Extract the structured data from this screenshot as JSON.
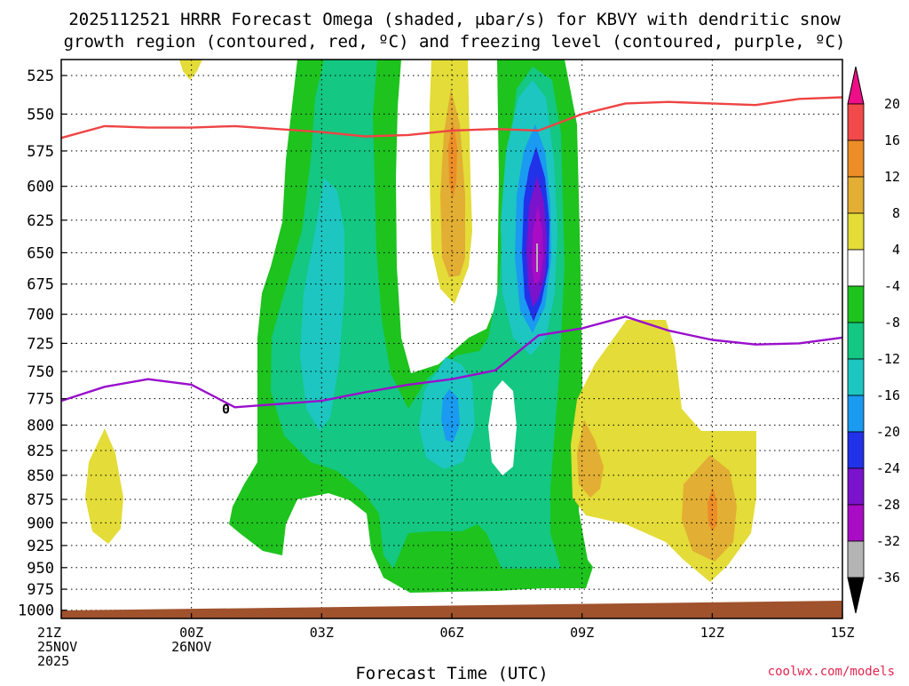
{
  "title": {
    "line1": "2025112521 HRRR Forecast Omega (shaded, μbar/s) for KBVY with dendritic snow",
    "line2": "growth region (contoured, red, ºC) and freezing level (contoured, purple, ºC)"
  },
  "credit": "coolwx.com/models",
  "chart_data": {
    "type": "area",
    "xlabel": "Forecast Time (UTC)",
    "ylabel": "",
    "x_ticks": [
      {
        "hour": 0,
        "label1": "21Z",
        "label2": "25NOV",
        "label3": "2025"
      },
      {
        "hour": 3,
        "label1": "00Z",
        "label2": "26NOV",
        "label3": ""
      },
      {
        "hour": 6,
        "label1": "03Z",
        "label2": "",
        "label3": ""
      },
      {
        "hour": 9,
        "label1": "06Z",
        "label2": "",
        "label3": ""
      },
      {
        "hour": 12,
        "label1": "09Z",
        "label2": "",
        "label3": ""
      },
      {
        "hour": 15,
        "label1": "12Z",
        "label2": "",
        "label3": ""
      },
      {
        "hour": 18,
        "label1": "15Z",
        "label2": "",
        "label3": ""
      }
    ],
    "xlim": [
      0,
      18
    ],
    "y_ticks": [
      525,
      550,
      575,
      600,
      625,
      650,
      675,
      700,
      725,
      750,
      775,
      800,
      825,
      850,
      875,
      900,
      925,
      950,
      975,
      1000
    ],
    "ylim": [
      1010,
      515
    ],
    "y_scale": "log-pressure",
    "grid": true,
    "colorbar": {
      "labels": [
        "20",
        "16",
        "12",
        "8",
        "4",
        "-4",
        "-8",
        "-12",
        "-16",
        "-20",
        "-24",
        "-28",
        "-32",
        "-36"
      ],
      "colors": [
        "#ee0e87",
        "#f24a4a",
        "#ec8d27",
        "#e2ae33",
        "#e4dc38",
        "#ffffff",
        "#1ec31e",
        "#14c782",
        "#1dc6c1",
        "#1a9af0",
        "#2132e8",
        "#7b12cc",
        "#a80cc4",
        "#b4b4b4",
        "#000000"
      ]
    },
    "series": [
      {
        "name": "freezing level",
        "color": "#9a0fcc",
        "contour_label": "0",
        "points": [
          {
            "hour": 0,
            "p": 777
          },
          {
            "hour": 1,
            "p": 764
          },
          {
            "hour": 2,
            "p": 757
          },
          {
            "hour": 3,
            "p": 762
          },
          {
            "hour": 4,
            "p": 783
          },
          {
            "hour": 6,
            "p": 777
          },
          {
            "hour": 7,
            "p": 769
          },
          {
            "hour": 8,
            "p": 762
          },
          {
            "hour": 9,
            "p": 757
          },
          {
            "hour": 10,
            "p": 749
          },
          {
            "hour": 11,
            "p": 718
          },
          {
            "hour": 12,
            "p": 712
          },
          {
            "hour": 13,
            "p": 702
          },
          {
            "hour": 14,
            "p": 714
          },
          {
            "hour": 15,
            "p": 722
          },
          {
            "hour": 16,
            "p": 726
          },
          {
            "hour": 17,
            "p": 725
          },
          {
            "hour": 18,
            "p": 720
          }
        ]
      },
      {
        "name": "dendritic snow growth region",
        "color": "#ef4444",
        "contour_label": "",
        "points": [
          {
            "hour": 0,
            "p": 566
          },
          {
            "hour": 1,
            "p": 558
          },
          {
            "hour": 2,
            "p": 559
          },
          {
            "hour": 3,
            "p": 559
          },
          {
            "hour": 4,
            "p": 558
          },
          {
            "hour": 6,
            "p": 562
          },
          {
            "hour": 7,
            "p": 565
          },
          {
            "hour": 8,
            "p": 564
          },
          {
            "hour": 9,
            "p": 561
          },
          {
            "hour": 10,
            "p": 560
          },
          {
            "hour": 11,
            "p": 561
          },
          {
            "hour": 12,
            "p": 550
          },
          {
            "hour": 13,
            "p": 543
          },
          {
            "hour": 14,
            "p": 542
          },
          {
            "hour": 15,
            "p": 543
          },
          {
            "hour": 16,
            "p": 544
          },
          {
            "hour": 17,
            "p": 540
          },
          {
            "hour": 18,
            "p": 539
          }
        ]
      }
    ],
    "shaded_regions": [
      {
        "band": "-8",
        "label": "west updraft, outer"
      },
      {
        "band": "-12",
        "label": "west updraft, core"
      },
      {
        "band": "-16",
        "label": "west updraft, innermost"
      },
      {
        "band": "-8",
        "label": "east updraft, outer"
      },
      {
        "band": "-32",
        "label": "east updraft max near 08Z 650mb"
      },
      {
        "band": "4",
        "label": "subsidence near 06Z 600mb"
      },
      {
        "band": "4",
        "label": "subsidence lower right"
      },
      {
        "band": "12",
        "label": "subsidence max near 12Z 890mb"
      }
    ]
  }
}
